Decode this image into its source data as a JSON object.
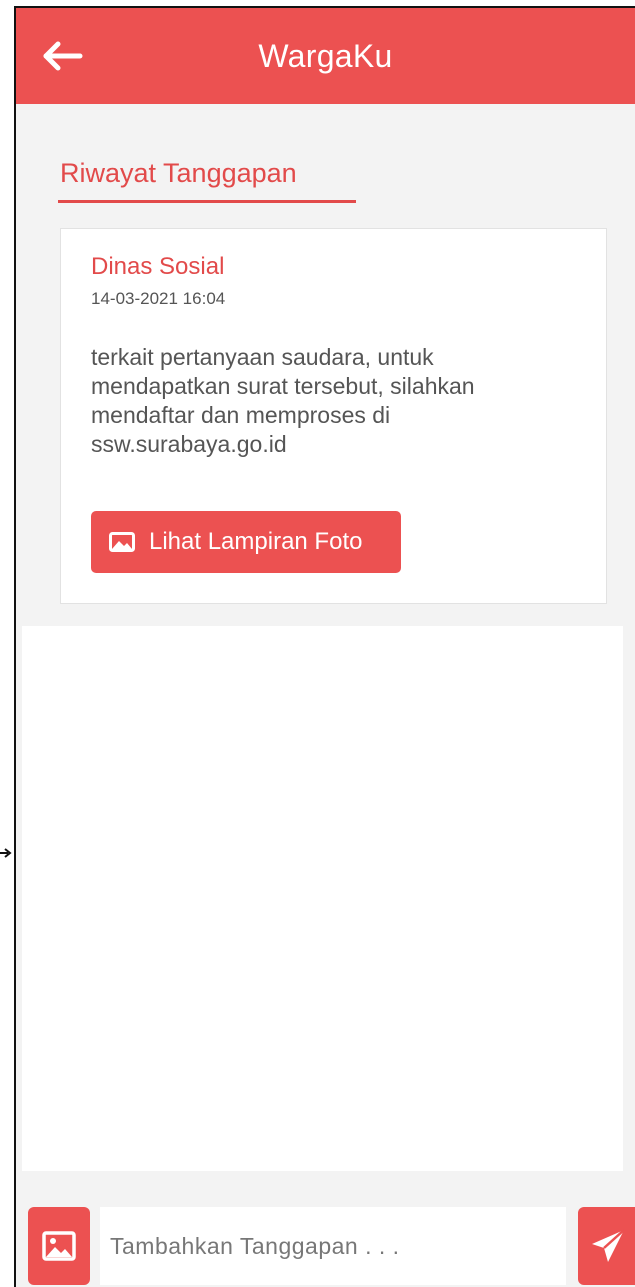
{
  "app": {
    "title": "WargaKu",
    "accent_color": "#ec5151",
    "back_icon": "arrow-left-icon"
  },
  "section": {
    "title": "Riwayat Tanggapan"
  },
  "responses": [
    {
      "agency": "Dinas Sosial",
      "timestamp": "14-03-2021 16:04",
      "message": "terkait pertanyaan saudara, untuk mendapatkan surat tersebut, silahkan mendaftar dan memproses di ssw.surabaya.go.id",
      "attachment_label": "Lihat Lampiran Foto",
      "attachment_icon": "image-icon"
    }
  ],
  "composer": {
    "placeholder": "Tambahkan Tanggapan . . .",
    "value": "",
    "image_icon": "image-icon",
    "send_icon": "send-icon"
  }
}
